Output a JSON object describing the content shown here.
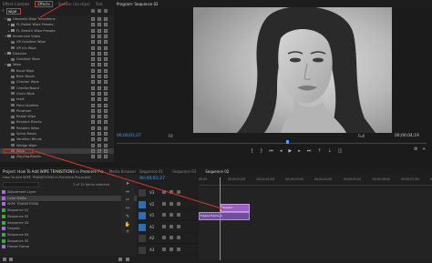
{
  "effects": {
    "tabs": [
      "Effect Controls",
      "Effects",
      "Source: (no clips)",
      "Text"
    ],
    "search_value": "wipe",
    "items": [
      {
        "label": "Obsolete Wipe Transitions",
        "indent": 1,
        "chev": "▾"
      },
      {
        "label": "FL Radial Wipe Presets",
        "indent": 2,
        "chev": "▸"
      },
      {
        "label": "FL Stretch Wipe Presets",
        "indent": 2,
        "chev": "▸"
      },
      {
        "label": "Immersive Video",
        "indent": 1,
        "chev": "▾"
      },
      {
        "label": "VR Gradient Wipe",
        "indent": 2,
        "chev": ""
      },
      {
        "label": "VR Iris Wipe",
        "indent": 2,
        "chev": ""
      },
      {
        "label": "Dissolve",
        "indent": 1,
        "chev": "▾"
      },
      {
        "label": "Gradient Wipe",
        "indent": 2,
        "chev": ""
      },
      {
        "label": "Wipe",
        "indent": 1,
        "chev": "▾"
      },
      {
        "label": "Band Wipe",
        "indent": 2,
        "chev": ""
      },
      {
        "label": "Barn Doors",
        "indent": 2,
        "chev": ""
      },
      {
        "label": "Checker Wipe",
        "indent": 2,
        "chev": ""
      },
      {
        "label": "CheckerBoard",
        "indent": 2,
        "chev": ""
      },
      {
        "label": "Clock Wipe",
        "indent": 2,
        "chev": ""
      },
      {
        "label": "Inset",
        "indent": 2,
        "chev": ""
      },
      {
        "label": "Paint Splatter",
        "indent": 2,
        "chev": ""
      },
      {
        "label": "Pinwheel",
        "indent": 2,
        "chev": ""
      },
      {
        "label": "Radial Wipe",
        "indent": 2,
        "chev": ""
      },
      {
        "label": "Random Blocks",
        "indent": 2,
        "chev": ""
      },
      {
        "label": "Random Wipe",
        "indent": 2,
        "chev": ""
      },
      {
        "label": "Spiral Boxes",
        "indent": 2,
        "chev": ""
      },
      {
        "label": "Venetian Blinds",
        "indent": 2,
        "chev": ""
      },
      {
        "label": "Wedge Wipe",
        "indent": 2,
        "chev": ""
      },
      {
        "label": "Wipe",
        "indent": 2,
        "chev": "",
        "selected": true
      },
      {
        "label": "Zig-Zag Blocks",
        "indent": 2,
        "chev": ""
      }
    ]
  },
  "program": {
    "title": "Program: Sequence 02",
    "timecode_left": "00;00;01;27",
    "fit": "Fit",
    "quality": "Full",
    "timecode_right": "00;00;04;19"
  },
  "project": {
    "tabs": [
      "Project: How To Add WIPE TRANSITIONS in Premiere Pro",
      "Media Browser"
    ],
    "path": "How To Add WIPE TRANSITIONS In Premiere Pro.prproj",
    "selection_info": "1 of 10 items selected",
    "items": [
      {
        "label": "Adjustment Layer",
        "color": "#a46bd6"
      },
      {
        "label": "Color Matte",
        "color": "#a46bd6"
      },
      {
        "label": "WIPE TRANSITIONS",
        "color": "#a46bd6"
      },
      {
        "label": "Sequence 01",
        "color": "#3aa64a"
      },
      {
        "label": "Sequence 02",
        "color": "#3aa64a"
      },
      {
        "label": "Sequence 03",
        "color": "#3aa64a"
      },
      {
        "label": "Graphic",
        "color": "#a46bd6"
      },
      {
        "label": "Sequence 04",
        "color": "#3aa64a"
      },
      {
        "label": "Sequence 05",
        "color": "#3aa64a"
      },
      {
        "label": "Freeze Frame",
        "color": "#a46bd6"
      }
    ]
  },
  "tabs2": {
    "sequence01": "Sequence 01",
    "sequence03": "Sequence 03",
    "sequence02": "Sequence 02"
  },
  "timeline": {
    "timecode": "00;00;01;27",
    "ruler": [
      "00;00",
      "00;00;01;00",
      "00;00;02;00",
      "00;00;03;00",
      "00;00;04;00",
      "00;00;05;00",
      "00;00;06;00",
      "00;00;07;00",
      "00;00;08;00"
    ],
    "clip_label": "Graphic",
    "clip2_label": "Freeze Frame.m",
    "tracks": [
      "V3",
      "V2",
      "V1",
      "A1",
      "A2",
      "A3"
    ]
  },
  "colors": {
    "accent_red": "#d9362b",
    "timeline_blue": "#2d6fb5",
    "clip_purple": "#9b5fc0",
    "playhead": "#4fa3ff"
  }
}
